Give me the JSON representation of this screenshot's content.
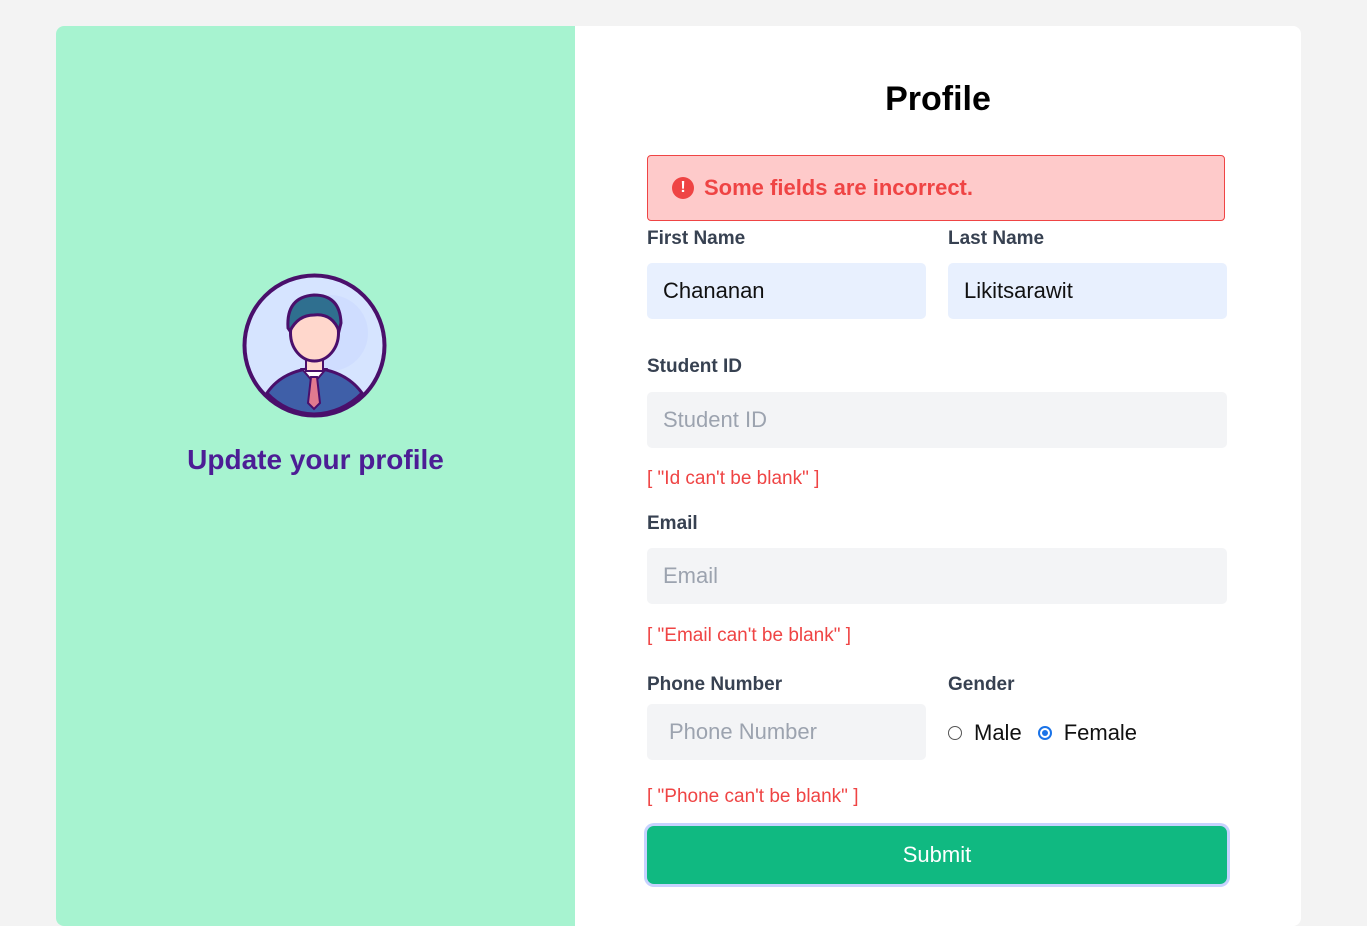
{
  "left_panel": {
    "title": "Update your profile",
    "avatar_icon": "businessman-avatar-icon"
  },
  "form": {
    "title": "Profile",
    "alert": {
      "icon": "exclamation-circle-icon",
      "text": "Some fields are incorrect.",
      "color": "#ef4444"
    },
    "first_name": {
      "label": "First Name",
      "value": "Chananan"
    },
    "last_name": {
      "label": "Last Name",
      "value": "Likitsarawit"
    },
    "student_id": {
      "label": "Student ID",
      "placeholder": "Student ID",
      "error": "[ \"Id can't be blank\" ]"
    },
    "email": {
      "label": "Email",
      "placeholder": "Email",
      "error": "[ \"Email can't be blank\" ]"
    },
    "phone": {
      "label": "Phone Number",
      "placeholder": "Phone Number",
      "error": "[ \"Phone can't be blank\" ]"
    },
    "gender": {
      "label": "Gender",
      "options": [
        "Male",
        "Female"
      ],
      "selected": "Female"
    },
    "submit_label": "Submit"
  },
  "colors": {
    "left_panel_bg": "#a7f3d0",
    "accent_title": "#4c1d95",
    "submit_bg": "#10b981",
    "error": "#ef4444"
  }
}
